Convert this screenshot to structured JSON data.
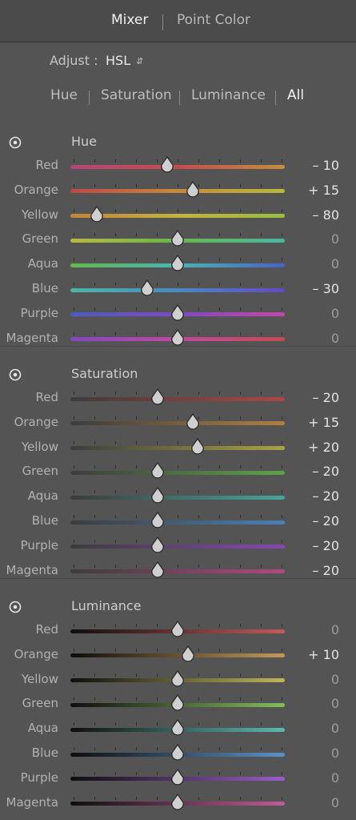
{
  "tabs": [
    {
      "label": "Mixer",
      "active": true
    },
    {
      "label": "Point Color",
      "active": false
    }
  ],
  "adjust": {
    "label": "Adjust :",
    "value": "HSL",
    "icon": "updown-chevron-icon"
  },
  "modes": [
    {
      "label": "Hue",
      "active": false
    },
    {
      "label": "Saturation",
      "active": false
    },
    {
      "label": "Luminance",
      "active": false
    },
    {
      "label": "All",
      "active": true
    }
  ],
  "sections": [
    {
      "key": "hue",
      "title": "Hue",
      "icon": "target-adjust-icon",
      "rows": [
        {
          "label": "Red",
          "value": -10,
          "display": "– 10",
          "gradient": [
            "#b8457a",
            "#c64c4c",
            "#c28f3d"
          ]
        },
        {
          "label": "Orange",
          "value": 15,
          "display": "+ 15",
          "gradient": [
            "#bf4747",
            "#c68a3a",
            "#b6b93c"
          ]
        },
        {
          "label": "Yellow",
          "value": -80,
          "display": "– 80",
          "gradient": [
            "#c4823a",
            "#c4b23c",
            "#9abd3e"
          ]
        },
        {
          "label": "Green",
          "value": 0,
          "display": "0",
          "gradient": [
            "#b8b83e",
            "#66b74a",
            "#4ab7a4"
          ]
        },
        {
          "label": "Aqua",
          "value": 0,
          "display": "0",
          "gradient": [
            "#64b94a",
            "#48b5b5",
            "#4a62c4"
          ]
        },
        {
          "label": "Blue",
          "value": -30,
          "display": "– 30",
          "gradient": [
            "#4ab7a5",
            "#4a87c4",
            "#6548c4"
          ]
        },
        {
          "label": "Purple",
          "value": 0,
          "display": "0",
          "gradient": [
            "#4a5cc4",
            "#8048c4",
            "#c448a8"
          ]
        },
        {
          "label": "Magenta",
          "value": 0,
          "display": "0",
          "gradient": [
            "#8048c4",
            "#c148a0",
            "#c44a52"
          ]
        }
      ]
    },
    {
      "key": "saturation",
      "title": "Saturation",
      "icon": "target-adjust-icon",
      "rows": [
        {
          "label": "Red",
          "value": -20,
          "display": "– 20",
          "gradient": [
            "#3c3c3c",
            "#b04444"
          ]
        },
        {
          "label": "Orange",
          "value": 15,
          "display": "+ 15",
          "gradient": [
            "#3c3c3c",
            "#b07f3f"
          ]
        },
        {
          "label": "Yellow",
          "value": 20,
          "display": "+ 20",
          "gradient": [
            "#3c3c3c",
            "#aaa340"
          ]
        },
        {
          "label": "Green",
          "value": -20,
          "display": "– 20",
          "gradient": [
            "#3c3c3c",
            "#5ea348"
          ]
        },
        {
          "label": "Aqua",
          "value": -20,
          "display": "– 20",
          "gradient": [
            "#3c3c3c",
            "#46a598"
          ]
        },
        {
          "label": "Blue",
          "value": -20,
          "display": "– 20",
          "gradient": [
            "#3c3c3c",
            "#4a80b8"
          ]
        },
        {
          "label": "Purple",
          "value": -20,
          "display": "– 20",
          "gradient": [
            "#3c3c3c",
            "#8648b4"
          ]
        },
        {
          "label": "Magenta",
          "value": -20,
          "display": "– 20",
          "gradient": [
            "#3c3c3c",
            "#b2487f"
          ]
        }
      ]
    },
    {
      "key": "luminance",
      "title": "Luminance",
      "icon": "target-adjust-icon",
      "rows": [
        {
          "label": "Red",
          "value": 0,
          "display": "0",
          "gradient": [
            "#0e0e0e",
            "#c25a5a"
          ]
        },
        {
          "label": "Orange",
          "value": 10,
          "display": "+ 10",
          "gradient": [
            "#0e0e0e",
            "#c29856"
          ]
        },
        {
          "label": "Yellow",
          "value": 0,
          "display": "0",
          "gradient": [
            "#0e0e0e",
            "#bdb65a"
          ]
        },
        {
          "label": "Green",
          "value": 0,
          "display": "0",
          "gradient": [
            "#0e0e0e",
            "#86be5a"
          ]
        },
        {
          "label": "Aqua",
          "value": 0,
          "display": "0",
          "gradient": [
            "#0e0e0e",
            "#5cbab0"
          ]
        },
        {
          "label": "Blue",
          "value": 0,
          "display": "0",
          "gradient": [
            "#0e0e0e",
            "#5a92c6"
          ]
        },
        {
          "label": "Purple",
          "value": 0,
          "display": "0",
          "gradient": [
            "#0e0e0e",
            "#9a5cc6"
          ]
        },
        {
          "label": "Magenta",
          "value": 0,
          "display": "0",
          "gradient": [
            "#0e0e0e",
            "#c25a96"
          ]
        }
      ]
    }
  ]
}
